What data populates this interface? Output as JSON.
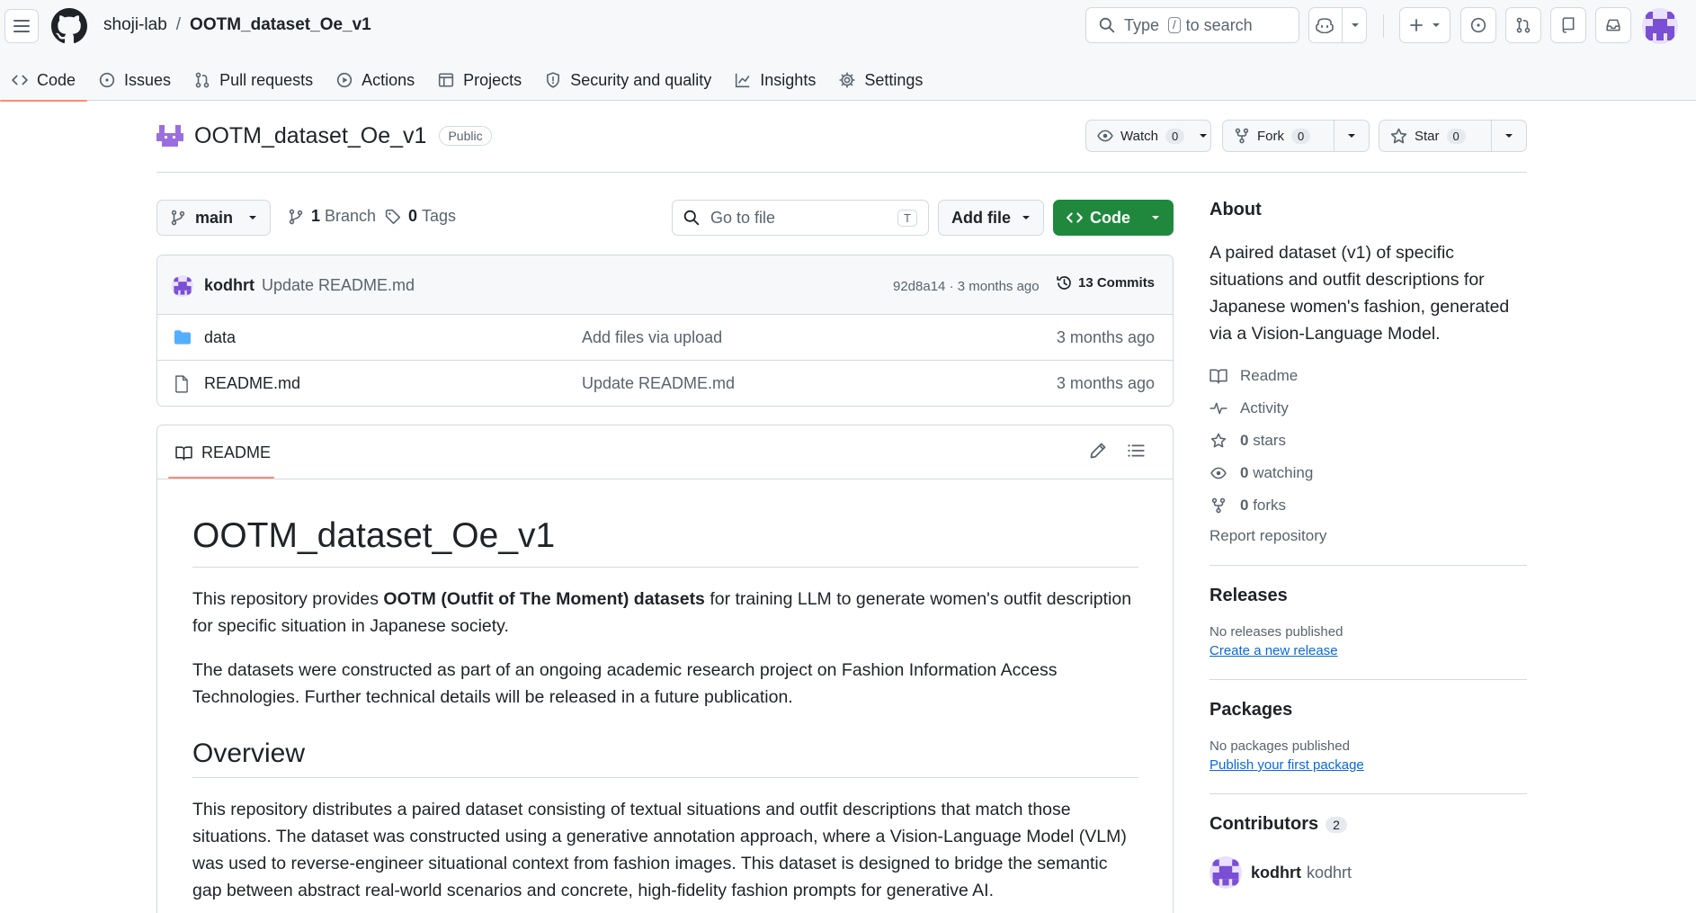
{
  "header": {
    "owner": "shoji-lab",
    "separator": "/",
    "repo": "OOTM_dataset_Oe_v1",
    "search_prefix": "Type",
    "search_key": "/",
    "search_suffix": "to search"
  },
  "repo_nav": [
    {
      "label": "Code",
      "icon": "code-icon",
      "selected": true
    },
    {
      "label": "Issues",
      "icon": "issue-icon"
    },
    {
      "label": "Pull requests",
      "icon": "pull-request-icon"
    },
    {
      "label": "Actions",
      "icon": "play-icon"
    },
    {
      "label": "Projects",
      "icon": "table-icon"
    },
    {
      "label": "Security and quality",
      "icon": "shield-icon"
    },
    {
      "label": "Insights",
      "icon": "graph-icon"
    },
    {
      "label": "Settings",
      "icon": "gear-icon"
    }
  ],
  "repo": {
    "name": "OOTM_dataset_Oe_v1",
    "visibility": "Public",
    "watch_label": "Watch",
    "watch_count": "0",
    "fork_label": "Fork",
    "fork_count": "0",
    "star_label": "Star",
    "star_count": "0"
  },
  "branch_bar": {
    "branch": "main",
    "branches_count": "1",
    "branches_label": "Branch",
    "tags_count": "0",
    "tags_label": "Tags",
    "goto_placeholder": "Go to file",
    "goto_key": "T",
    "add_file": "Add file",
    "code": "Code"
  },
  "latest_commit": {
    "user": "kodhrt",
    "message": "Update README.md",
    "sha_time": "92d8a14 · 3 months ago",
    "commits_count": "13 Commits"
  },
  "files": [
    {
      "type": "folder",
      "name": "data",
      "message": "Add files via upload",
      "age": "3 months ago"
    },
    {
      "type": "file",
      "name": "README.md",
      "message": "Update README.md",
      "age": "3 months ago"
    }
  ],
  "readme": {
    "tab": "README",
    "title": "OOTM_dataset_Oe_v1",
    "p1_pre": "This repository provides ",
    "p1_bold": "OOTM (Outfit of The Moment) datasets",
    "p1_post": " for training LLM to generate women's outfit description for specific situation in Japanese society.",
    "p2": "The datasets were constructed as part of an ongoing academic research project on Fashion Information Access Technologies. Further technical details will be released in a future publication.",
    "h2": "Overview",
    "p3": "This repository distributes a paired dataset consisting of textual situations and outfit descriptions that match those situations. The dataset was constructed using a generative annotation approach, where a Vision-Language Model (VLM) was used to reverse-engineer situational context from fashion images. This dataset is designed to bridge the semantic gap between abstract real-world scenarios and concrete, high-fidelity fashion prompts for generative AI."
  },
  "sidebar": {
    "about_title": "About",
    "about_text": "A paired dataset (v1) of specific situations and outfit descriptions for Japanese women's fashion, generated via a Vision-Language Model.",
    "links": [
      {
        "icon": "book-icon",
        "count": "",
        "label": "Readme"
      },
      {
        "icon": "pulse-icon",
        "count": "",
        "label": "Activity"
      },
      {
        "icon": "star-icon",
        "count": "0",
        "label": "stars"
      },
      {
        "icon": "eye-icon",
        "count": "0",
        "label": "watching"
      },
      {
        "icon": "fork-icon",
        "count": "0",
        "label": "forks"
      }
    ],
    "report": "Report repository",
    "releases_title": "Releases",
    "releases_empty": "No releases published",
    "releases_link": "Create a new release",
    "packages_title": "Packages",
    "packages_empty": "No packages published",
    "packages_link": "Publish your first package",
    "contributors_title": "Contributors",
    "contributors_count": "2",
    "contributor_user": "kodhrt",
    "contributor_name": "kodhrt"
  },
  "colors": {
    "accent_green": "#1f883d",
    "tab_underline": "#fd8c73",
    "link_blue": "#0969da",
    "avatar_purple": "#7b4fd4"
  }
}
